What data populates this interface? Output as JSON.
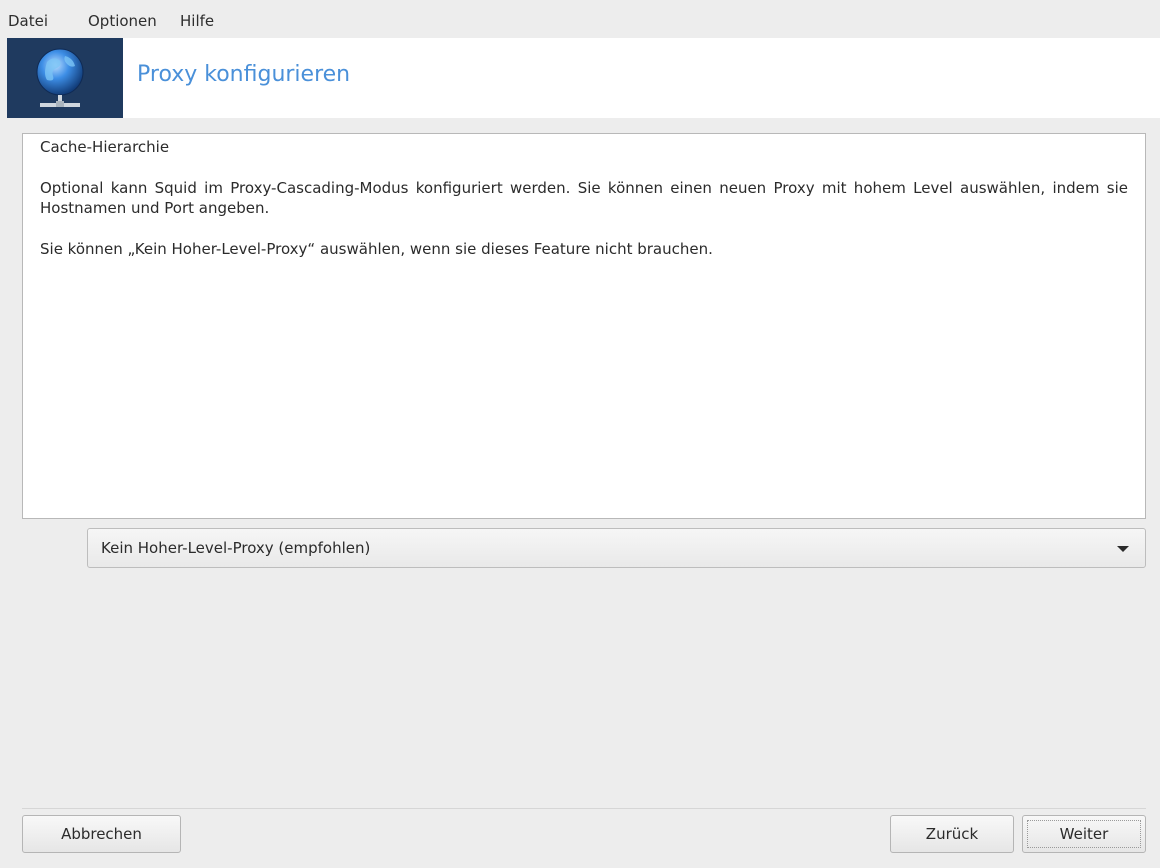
{
  "menubar": {
    "items": [
      "Datei",
      "Optionen",
      "Hilfe"
    ]
  },
  "header": {
    "title": "Proxy konfigurieren",
    "icon": "network-globe-icon"
  },
  "content": {
    "heading": "Cache-Hierarchie",
    "paragraph1": "Optional kann Squid im Proxy-Cascading-Modus konfiguriert werden. Sie können einen neuen Proxy mit hohem Level auswählen, indem sie Hostnamen und Port angeben.",
    "paragraph2": "Sie können „Kein Hoher-Level-Proxy“ auswählen, wenn sie dieses Feature nicht brauchen."
  },
  "combo": {
    "selected": "Kein Hoher-Level-Proxy (empfohlen)"
  },
  "buttons": {
    "cancel": "Abbrechen",
    "back": "Zurück",
    "next": "Weiter"
  },
  "colors": {
    "title": "#4a90d9",
    "logo_bg": "#1f3a5f"
  }
}
